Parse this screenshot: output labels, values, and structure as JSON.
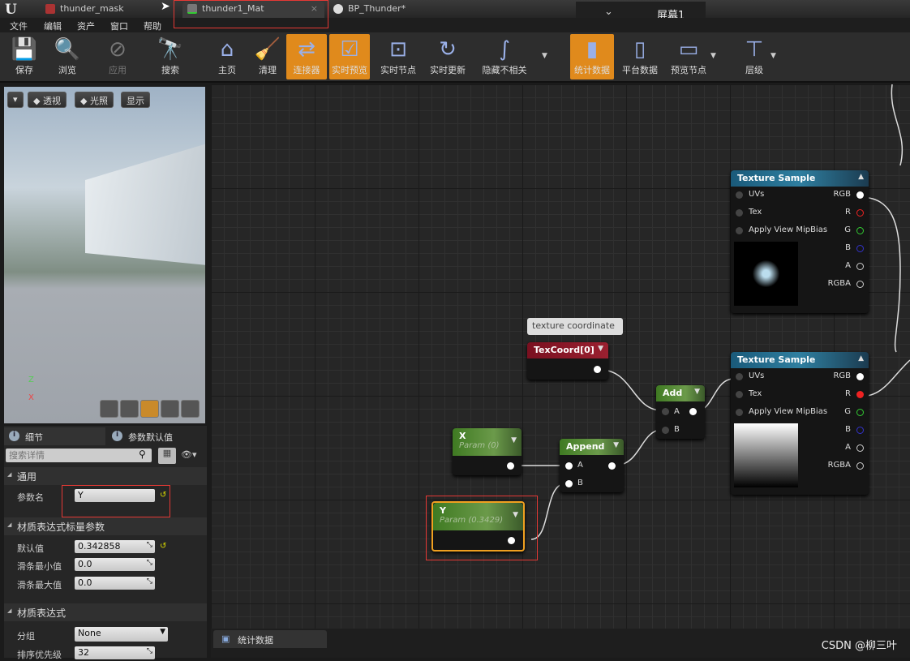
{
  "tabs": [
    {
      "label": "thunder_mask",
      "active": false
    },
    {
      "label": "thunder1_Mat",
      "active": true
    },
    {
      "label": "BP_Thunder*",
      "active": false
    }
  ],
  "screen_selector": {
    "label": "屏幕1"
  },
  "menu": [
    "文件",
    "编辑",
    "资产",
    "窗口",
    "帮助"
  ],
  "toolbar": [
    {
      "label": "保存",
      "icon": "save-icon",
      "state": "normal"
    },
    {
      "label": "浏览",
      "icon": "browse-icon",
      "state": "normal"
    },
    {
      "label": "应用",
      "icon": "apply-icon",
      "state": "disabled"
    },
    {
      "label": "搜索",
      "icon": "search-icon",
      "state": "normal"
    },
    {
      "label": "主页",
      "icon": "home-icon",
      "state": "normal"
    },
    {
      "label": "清理",
      "icon": "clean-icon",
      "state": "normal"
    },
    {
      "label": "连接器",
      "icon": "connector-icon",
      "state": "active"
    },
    {
      "label": "实时预览",
      "icon": "live-preview-icon",
      "state": "active"
    },
    {
      "label": "实时节点",
      "icon": "live-nodes-icon",
      "state": "normal"
    },
    {
      "label": "实时更新",
      "icon": "live-update-icon",
      "state": "normal"
    },
    {
      "label": "隐藏不相关",
      "icon": "hide-unrelated-icon",
      "state": "normal"
    },
    {
      "label": "统计数据",
      "icon": "stats-icon",
      "state": "active"
    },
    {
      "label": "平台数据",
      "icon": "platform-stats-icon",
      "state": "normal"
    },
    {
      "label": "预览节点",
      "icon": "preview-node-icon",
      "state": "normal"
    },
    {
      "label": "层级",
      "icon": "hierarchy-icon",
      "state": "normal"
    }
  ],
  "viewport": {
    "perspective": "透视",
    "lighting": "光照",
    "show": "显示",
    "axis_z": "Z",
    "axis_x": "X"
  },
  "details": {
    "tab_details": "细节",
    "tab_params": "参数默认值",
    "search_placeholder": "搜索详情",
    "section_general": "通用",
    "param_name_label": "参数名",
    "param_name_value": "Y",
    "section_scalar": "材质表达式标量参数",
    "default_label": "默认值",
    "default_value": "0.342858",
    "slider_min_label": "滑条最小值",
    "slider_min_value": "0.0",
    "slider_max_label": "滑条最大值",
    "slider_max_value": "0.0",
    "section_expr": "材质表达式",
    "group_label": "分组",
    "group_value": "None",
    "priority_label": "排序优先级",
    "priority_value": "32"
  },
  "graph": {
    "comment": "texture coordinate",
    "texcoord": {
      "title": "TexCoord[0]"
    },
    "x_param": {
      "title": "X",
      "sub": "Param (0)"
    },
    "y_param": {
      "title": "Y",
      "sub": "Param (0.3429)"
    },
    "append": {
      "title": "Append",
      "a": "A",
      "b": "B"
    },
    "add": {
      "title": "Add",
      "a": "A",
      "b": "B"
    },
    "tex1": {
      "title": "Texture Sample",
      "uvs": "UVs",
      "tex": "Tex",
      "mip": "Apply View MipBias",
      "rgb": "RGB",
      "r": "R",
      "g": "G",
      "b": "B",
      "a": "A",
      "rgba": "RGBA"
    },
    "tex2": {
      "title": "Texture Sample",
      "uvs": "UVs",
      "tex": "Tex",
      "mip": "Apply View MipBias",
      "rgb": "RGB",
      "r": "R",
      "g": "G",
      "b": "B",
      "a": "A",
      "rgba": "RGBA"
    }
  },
  "bottom_tab": "统计数据",
  "watermark": "CSDN @柳三叶"
}
